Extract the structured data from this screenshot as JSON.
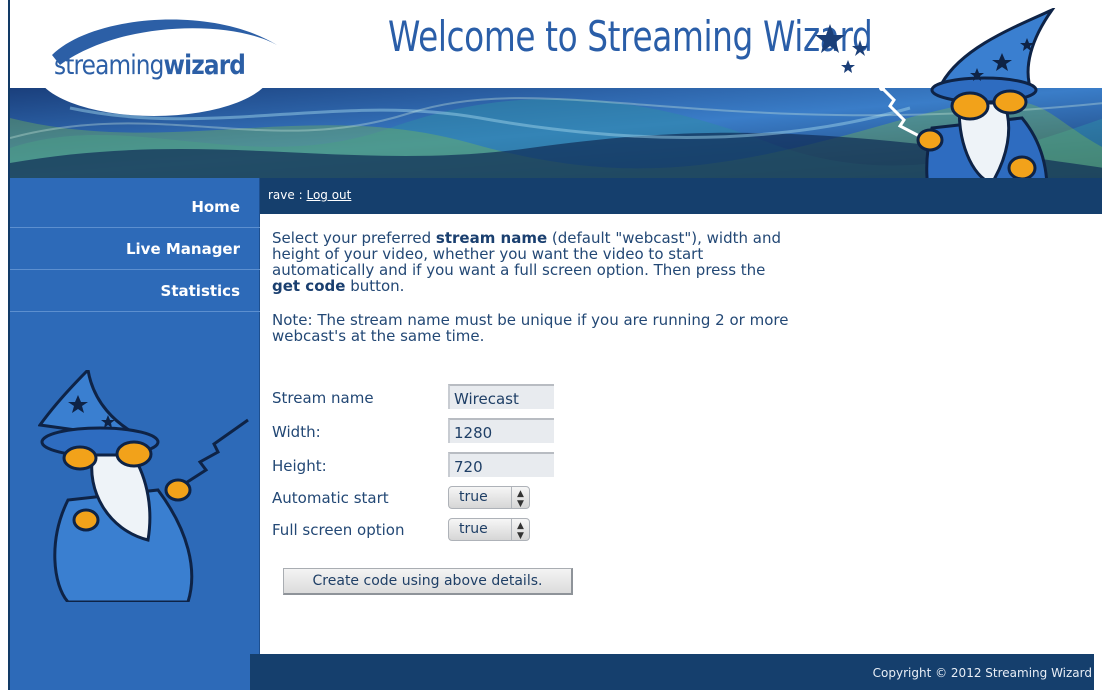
{
  "header": {
    "logo_prefix": "streaming",
    "logo_suffix": "wizard",
    "title": "Welcome to Streaming Wizard"
  },
  "sidebar": {
    "items": [
      {
        "label": "Home"
      },
      {
        "label": "Live Manager"
      },
      {
        "label": "Statistics"
      }
    ]
  },
  "userbar": {
    "username": "rave :",
    "logout_label": "Log out"
  },
  "intro": {
    "text_1": "Select your preferred ",
    "bold_1": "stream name",
    "text_2": " (default \"webcast\"), width and height of your video, whether you want the video to start automatically and if you want a full screen option. Then press the ",
    "bold_2": "get code",
    "text_3": " button.",
    "note": "Note: The stream name must be unique if you are running 2 or more webcast's at the same time."
  },
  "form": {
    "stream_name_label": "Stream name",
    "stream_name_value": "Wirecast",
    "width_label": "Width:",
    "width_value": "1280",
    "height_label": "Height:",
    "height_value": "720",
    "auto_start_label": "Automatic start",
    "auto_start_value": "true",
    "fullscreen_label": "Full screen option",
    "fullscreen_value": "true",
    "submit_label": "Create code using above details."
  },
  "footer": {
    "copyright": "Copyright © 2012 Streaming Wizard"
  },
  "colors": {
    "brand_blue": "#2d6ab8",
    "dark_navy": "#153f6d",
    "title_blue": "#2a5ea8"
  },
  "icons": {
    "top_mascot": "wizard-mascot",
    "side_mascot": "wizard-mascot",
    "stars": "stars-icon",
    "select_arrows": "updown-arrows-icon"
  }
}
